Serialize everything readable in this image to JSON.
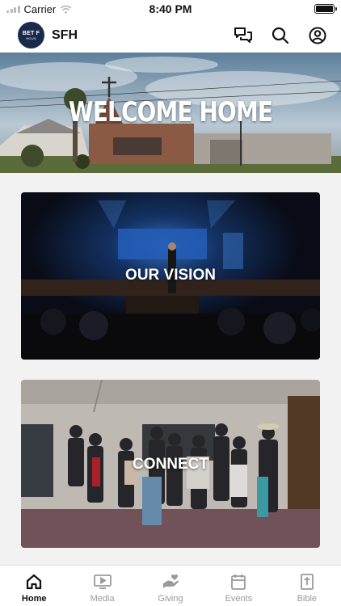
{
  "status_bar": {
    "carrier": "Carrier",
    "time": "8:40 PM"
  },
  "header": {
    "logo_text": "BET F",
    "logo_subtext": "HOUS",
    "title": "SFH",
    "actions": [
      {
        "name": "chat-icon"
      },
      {
        "name": "search-icon"
      },
      {
        "name": "profile-icon"
      }
    ]
  },
  "hero": {
    "title": "WELCOME HOME"
  },
  "cards": {
    "vision": {
      "label": "OUR VISION"
    },
    "connect": {
      "label": "CONNECT"
    }
  },
  "bottom_nav": {
    "active": "Home",
    "items": [
      {
        "label": "Home",
        "icon": "home-icon"
      },
      {
        "label": "Media",
        "icon": "play-screen-icon"
      },
      {
        "label": "Giving",
        "icon": "giving-hand-icon"
      },
      {
        "label": "Events",
        "icon": "calendar-icon"
      },
      {
        "label": "Bible",
        "icon": "bible-icon"
      }
    ]
  },
  "colors": {
    "active": "#111111",
    "inactive": "#9a9a9a",
    "logo_bg": "#1b2a4a"
  }
}
